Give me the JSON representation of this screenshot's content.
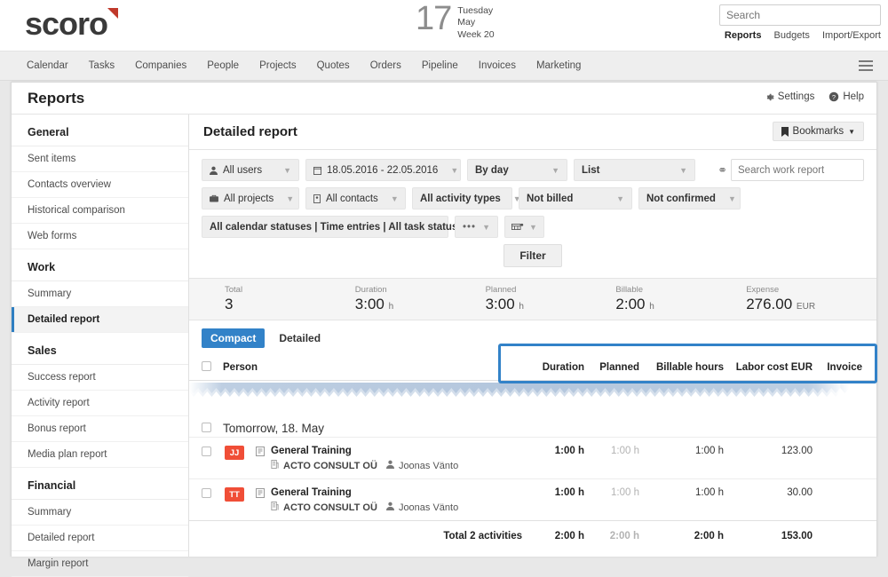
{
  "brand": {
    "name": "scoro",
    "accent": "#c0392b"
  },
  "header": {
    "date_number": "17",
    "date_weekday": "Tuesday",
    "date_month": "May",
    "date_week": "Week 20",
    "search_placeholder": "Search",
    "search_value": "",
    "sublinks": [
      {
        "label": "Reports",
        "active": true
      },
      {
        "label": "Budgets",
        "active": false
      },
      {
        "label": "Import/Export",
        "active": false
      }
    ]
  },
  "nav": {
    "items": [
      "Calendar",
      "Tasks",
      "Companies",
      "People",
      "Projects",
      "Quotes",
      "Orders",
      "Pipeline",
      "Invoices",
      "Marketing"
    ]
  },
  "app": {
    "title": "Reports",
    "settings_label": "Settings",
    "help_label": "Help"
  },
  "sidebar": {
    "groups": [
      {
        "title": "General",
        "items": [
          {
            "label": "Sent items",
            "active": false
          },
          {
            "label": "Contacts overview",
            "active": false
          },
          {
            "label": "Historical comparison",
            "active": false
          },
          {
            "label": "Web forms",
            "active": false
          }
        ]
      },
      {
        "title": "Work",
        "items": [
          {
            "label": "Summary",
            "active": false
          },
          {
            "label": "Detailed report",
            "active": true
          }
        ]
      },
      {
        "title": "Sales",
        "items": [
          {
            "label": "Success report",
            "active": false
          },
          {
            "label": "Activity report",
            "active": false
          },
          {
            "label": "Bonus report",
            "active": false
          },
          {
            "label": "Media plan report",
            "active": false
          }
        ]
      },
      {
        "title": "Financial",
        "items": [
          {
            "label": "Summary",
            "active": false
          },
          {
            "label": "Detailed report",
            "active": false
          },
          {
            "label": "Margin report",
            "active": false
          }
        ]
      }
    ]
  },
  "main": {
    "title": "Detailed report",
    "bookmarks_label": "Bookmarks",
    "filters": {
      "users": "All users",
      "date_range": "18.05.2016 - 22.05.2016",
      "grouping": "By day",
      "view": "List",
      "projects": "All projects",
      "contacts": "All contacts",
      "activity_types": "All activity types",
      "billed": "Not billed",
      "confirmed": "Not confirmed",
      "statuses": "All calendar statuses | Time entries | All task statuses",
      "more": "•••",
      "search_work_placeholder": "Search work report",
      "search_work_value": "",
      "filter_button": "Filter"
    },
    "summary": [
      {
        "label": "Total",
        "value": "3",
        "unit": ""
      },
      {
        "label": "Duration",
        "value": "3:00",
        "unit": "h"
      },
      {
        "label": "Planned",
        "value": "3:00",
        "unit": "h"
      },
      {
        "label": "Billable",
        "value": "2:00",
        "unit": "h"
      },
      {
        "label": "Expense",
        "value": "276.00",
        "unit": "EUR"
      }
    ],
    "tabs": [
      {
        "label": "Compact",
        "active": true
      },
      {
        "label": "Detailed",
        "active": false
      }
    ],
    "highlight_color": "#3282c8",
    "table": {
      "columns": {
        "person": "Person",
        "duration": "Duration",
        "planned": "Planned",
        "billable": "Billable hours",
        "labor_cost": "Labor cost EUR",
        "invoice": "Invoice"
      },
      "date_group": "Tomorrow, 18. May",
      "rows": [
        {
          "initials": "JJ",
          "title": "General Training",
          "company": "ACTO CONSULT OÜ",
          "person": "Joonas Vänto",
          "duration": "1:00 h",
          "planned": "1:00 h",
          "billable": "1:00 h",
          "labor_cost": "123.00",
          "invoice": ""
        },
        {
          "initials": "TT",
          "title": "General Training",
          "company": "ACTO CONSULT OÜ",
          "person": "Joonas Vänto",
          "duration": "1:00 h",
          "planned": "1:00 h",
          "billable": "1:00 h",
          "labor_cost": "30.00",
          "invoice": ""
        }
      ],
      "total": {
        "label": "Total 2 activities",
        "duration": "2:00 h",
        "planned": "2:00 h",
        "billable": "2:00 h",
        "labor_cost": "153.00",
        "invoice": ""
      }
    }
  }
}
